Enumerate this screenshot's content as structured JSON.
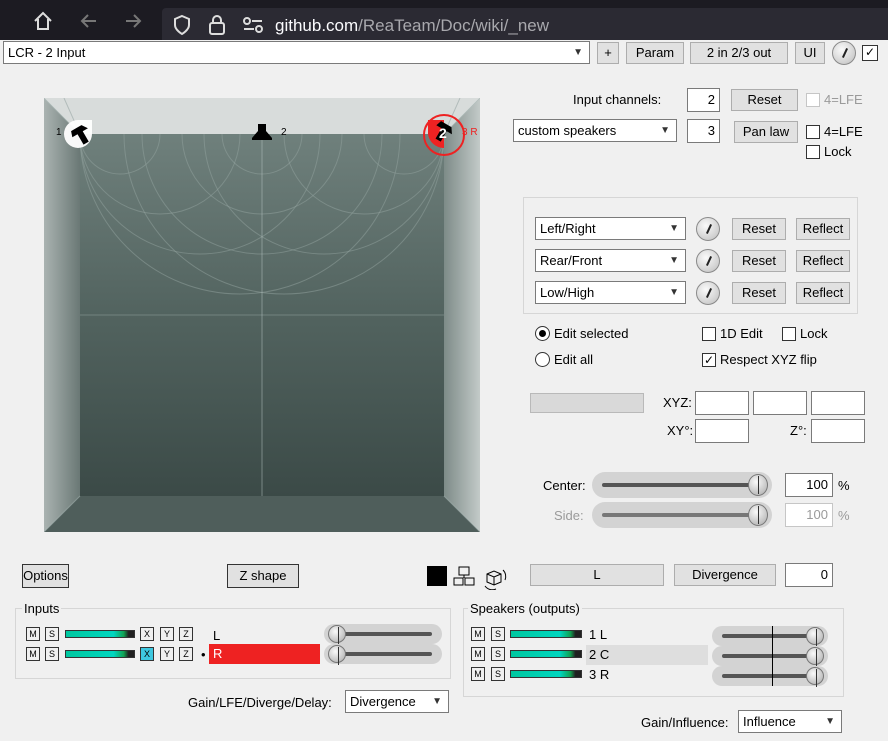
{
  "browser": {
    "url_host": "github.com",
    "url_path": "/ReaTeam/Doc/wiki/_new",
    "home_icon": "home-icon",
    "back_icon": "back-arrow-icon",
    "forward_icon": "forward-arrow-icon"
  },
  "header": {
    "preset": "LCR - 2 Input",
    "plus_label": "+",
    "param_label": "Param",
    "io_label": "2 in 2/3 out",
    "ui_label": "UI"
  },
  "room": {
    "speakers": [
      {
        "label": "1"
      },
      {
        "label": "2"
      },
      {
        "label": "3 R"
      }
    ],
    "input_marker": "2"
  },
  "input_channels": {
    "label": "Input channels:",
    "value": "2",
    "reset_label": "Reset",
    "lfe_label": "4=LFE"
  },
  "speakers_config": {
    "mode": "custom speakers",
    "count": "3",
    "panlaw_label": "Pan law",
    "lfe_label": "4=LFE",
    "lock_label": "Lock"
  },
  "axes": [
    {
      "mode": "Left/Right",
      "reset": "Reset",
      "reflect": "Reflect"
    },
    {
      "mode": "Rear/Front",
      "reset": "Reset",
      "reflect": "Reflect"
    },
    {
      "mode": "Low/High",
      "reset": "Reset",
      "reflect": "Reflect"
    }
  ],
  "edit": {
    "edit_selected": "Edit selected",
    "edit_all": "Edit all",
    "edit_1d": "1D Edit",
    "lock": "Lock",
    "respect_xyz": "Respect XYZ flip",
    "respect_check": "✓"
  },
  "coords": {
    "xyz_label": "XYZ:",
    "xy_label": "XY°:",
    "z_label": "Z°:"
  },
  "center": {
    "label": "Center:",
    "value": "100",
    "unit": "%",
    "level": 1.0
  },
  "side": {
    "label": "Side:",
    "value": "100",
    "unit": "%",
    "level": 1.0
  },
  "bottom_row": {
    "options_label": "Options",
    "zshape_label": "Z shape",
    "channel_label": "L",
    "divergence_label": "Divergence",
    "divergence_value": "0"
  },
  "inputs": {
    "title": "Inputs",
    "rows": [
      {
        "m": "M",
        "s": "S",
        "x": "X",
        "y": "Y",
        "z": "Z",
        "name": "L"
      },
      {
        "m": "M",
        "s": "S",
        "x": "X",
        "y": "Y",
        "z": "Z",
        "name": "R"
      }
    ],
    "selected_marker": "•",
    "gain_label": "Gain/LFE/Diverge/Delay:",
    "gain_mode": "Divergence"
  },
  "outputs": {
    "title": "Speakers (outputs)",
    "rows": [
      {
        "m": "M",
        "s": "S",
        "name": "1 L"
      },
      {
        "m": "M",
        "s": "S",
        "name": "2 C"
      },
      {
        "m": "M",
        "s": "S",
        "name": "3 R"
      }
    ],
    "gain_label": "Gain/Influence:",
    "gain_mode": "Influence"
  },
  "colors": {
    "accent_red": "#ee2222",
    "meter_cyan": "#00d6c0",
    "button_bg": "#e1e1e1"
  }
}
